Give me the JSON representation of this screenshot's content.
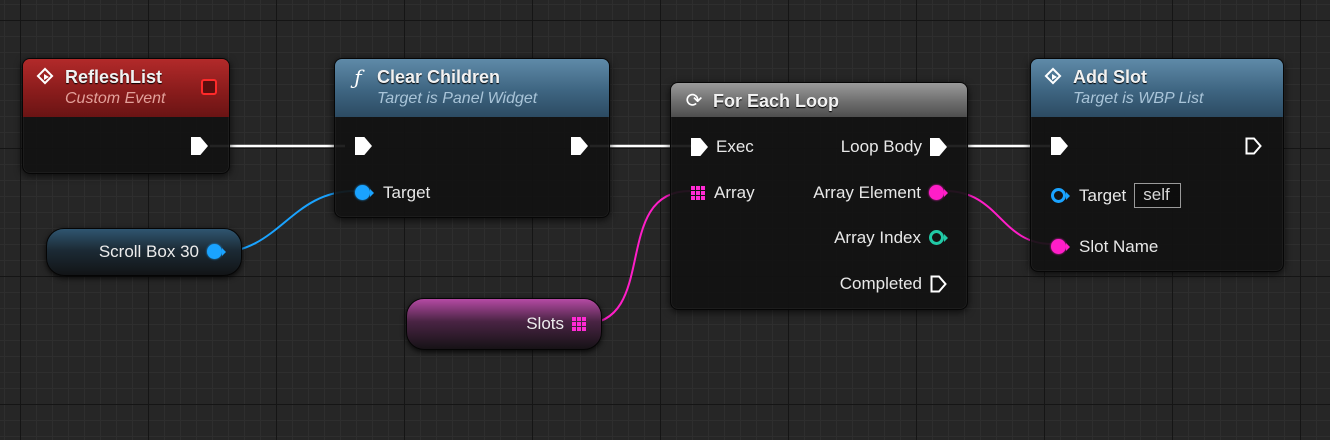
{
  "colors": {
    "exec_wire": "#ffffff",
    "object_pin": "#1aa3ff",
    "name_pin": "#ff1ec8",
    "int_pin": "#21c9a6",
    "event_header": "#9c2222",
    "function_header": "#4a7391",
    "macro_header": "#7a7a7a"
  },
  "nodes": {
    "custom_event": {
      "title": "RefleshList",
      "subtitle": "Custom Event",
      "icon": "event-diamond-icon"
    },
    "clear_children": {
      "title": "Clear Children",
      "subtitle": "Target is Panel Widget",
      "icon": "function-icon",
      "target_label": "Target"
    },
    "for_each": {
      "title": "For Each Loop",
      "icon": "loop-icon",
      "exec_label": "Exec",
      "array_label": "Array",
      "loop_body_label": "Loop Body",
      "array_element_label": "Array Element",
      "array_index_label": "Array Index",
      "completed_label": "Completed"
    },
    "add_slot": {
      "title": "Add Slot",
      "subtitle": "Target is WBP List",
      "icon": "event-diamond-icon",
      "target_label": "Target",
      "target_default": "self",
      "slot_name_label": "Slot Name"
    },
    "scroll_box": {
      "label": "Scroll Box 30"
    },
    "slots": {
      "label": "Slots"
    }
  }
}
